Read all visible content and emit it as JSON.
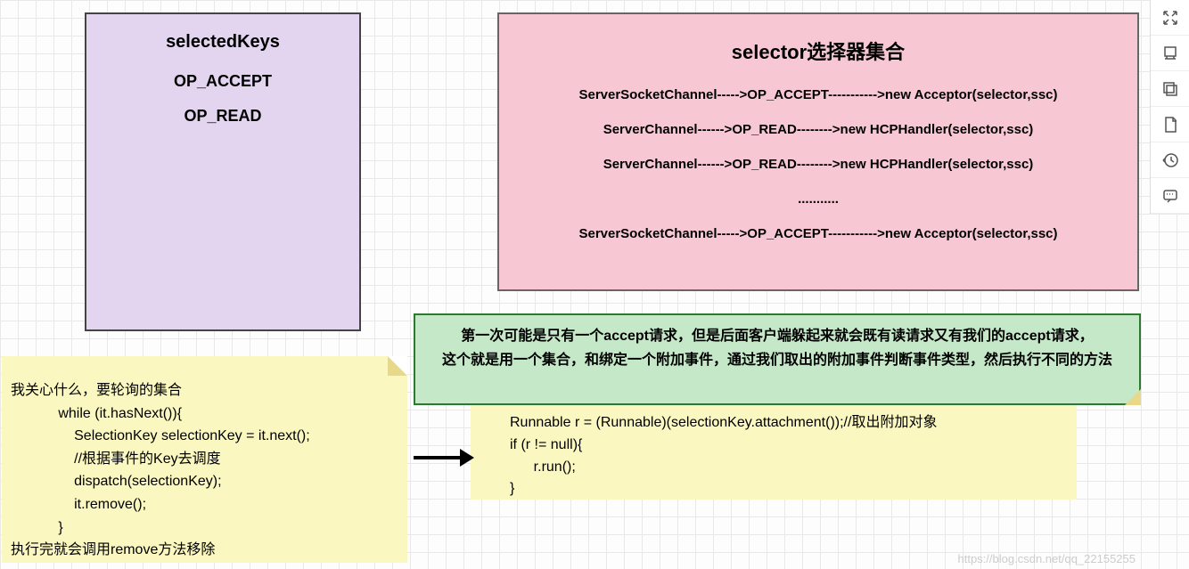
{
  "purple": {
    "title": "selectedKeys",
    "l1": "OP_ACCEPT",
    "l2": "OP_READ"
  },
  "pink": {
    "title": "selector选择器集合",
    "rows": [
      "ServerSocketChannel----->OP_ACCEPT----------->new Acceptor(selector,ssc)",
      "ServerChannel------>OP_READ-------->new  HCPHandler(selector,ssc)",
      "ServerChannel------>OP_READ-------->new  HCPHandler(selector,ssc)",
      "...........",
      "ServerSocketChannel----->OP_ACCEPT----------->new Acceptor(selector,ssc)"
    ]
  },
  "green": {
    "l1": "第一次可能是只有一个accept请求，但是后面客户端躲起来就会既有读请求又有我们的accept请求，",
    "l2": "这个就是用一个集合，和绑定一个附加事件，通过我们取出的附加事件判断事件类型，然后执行不同的方法"
  },
  "note1": {
    "pre": "我关心什么，要轮询的集合\n            while (it.hasNext()){\n                SelectionKey selectionKey = it.next();\n                //根据事件的Key去调度\n                dispatch(selectionKey);\n                it.remove();\n            }\n执行完就会调用remove方法移除"
  },
  "note2": {
    "pre": "Runnable r = (Runnable)(selectionKey.attachment());//取出附加对象\nif (r != null){\n      r.run();\n}"
  },
  "toolbar": {
    "i1": "expand-icon",
    "i2": "layers-icon",
    "i3": "copy-icon",
    "i4": "page-icon",
    "i5": "history-icon",
    "i6": "comment-icon"
  },
  "watermark": "https://blog.csdn.net/qq_22155255"
}
